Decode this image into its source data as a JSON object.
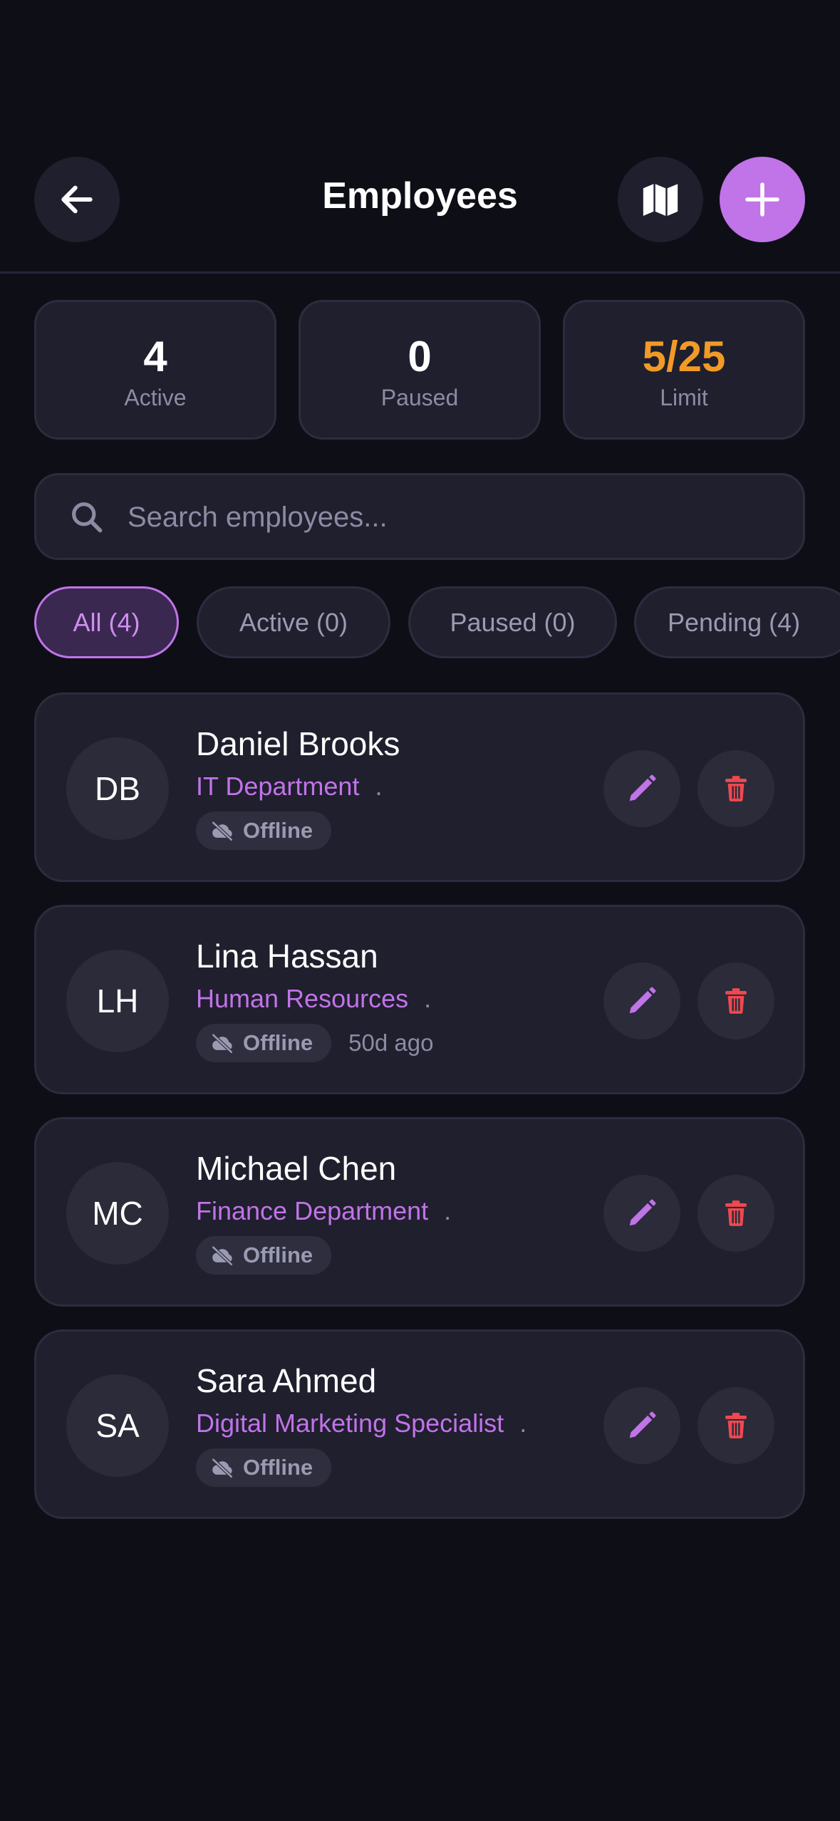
{
  "header": {
    "title": "Employees",
    "back_icon": "arrow-left-icon",
    "map_icon": "map-icon",
    "add_icon": "plus-icon"
  },
  "stats": [
    {
      "value": "4",
      "label": "Active"
    },
    {
      "value": "0",
      "label": "Paused"
    },
    {
      "value": "5/25",
      "label": "Limit"
    }
  ],
  "search": {
    "placeholder": "Search employees...",
    "value": ""
  },
  "filters": [
    {
      "label": "All (4)",
      "selected": true
    },
    {
      "label": "Active (0)",
      "selected": false
    },
    {
      "label": "Paused (0)",
      "selected": false
    },
    {
      "label": "Pending (4)",
      "selected": false
    }
  ],
  "employees": [
    {
      "initials": "DB",
      "name": "Daniel Brooks",
      "department": "IT Department",
      "dot": ".",
      "status": "Offline",
      "last_seen": ""
    },
    {
      "initials": "LH",
      "name": "Lina Hassan",
      "department": "Human Resources",
      "dot": ".",
      "status": "Offline",
      "last_seen": "50d ago"
    },
    {
      "initials": "MC",
      "name": "Michael Chen",
      "department": "Finance Department",
      "dot": ".",
      "status": "Offline",
      "last_seen": ""
    },
    {
      "initials": "SA",
      "name": "Sara Ahmed",
      "department": "Digital Marketing Specialist",
      "dot": ".",
      "status": "Offline",
      "last_seen": ""
    }
  ],
  "colors": {
    "background": "#0e0e17",
    "card": "#1f1f2e",
    "accent": "#c173e8",
    "limit": "#f29a26",
    "danger": "#f0484f",
    "muted": "#8b8ba3"
  }
}
